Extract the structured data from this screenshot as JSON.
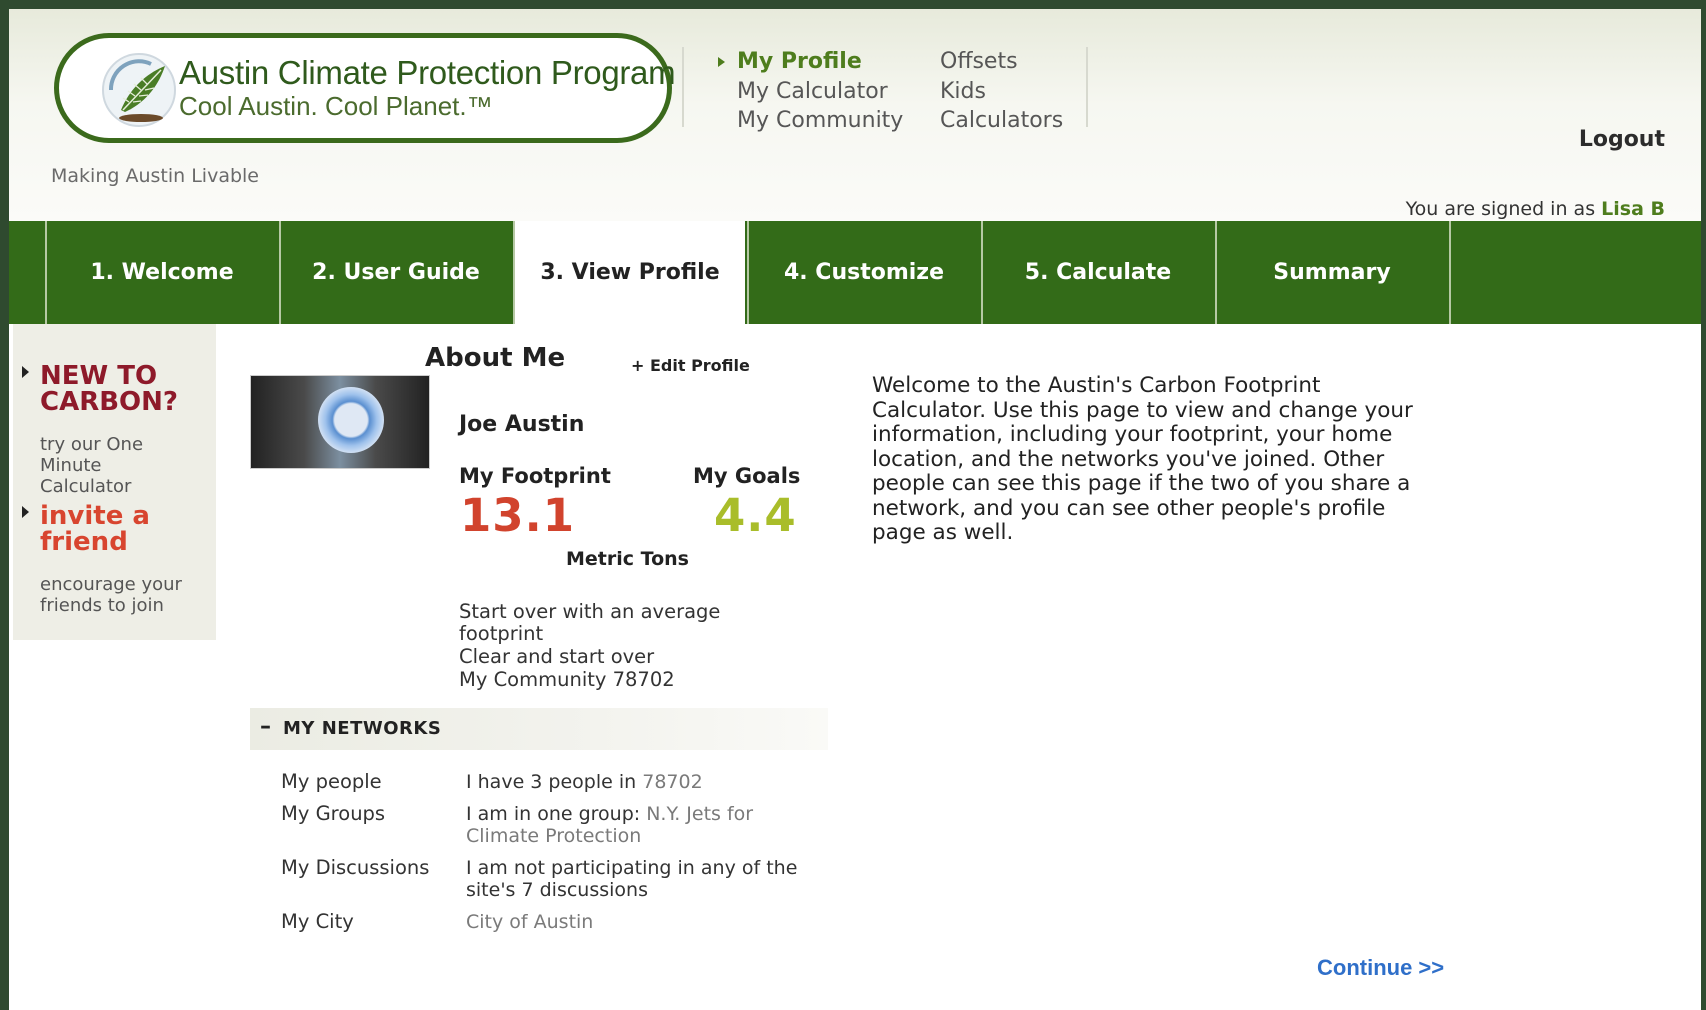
{
  "header": {
    "logo_title": "Austin Climate Protection Program",
    "logo_slogan": "Cool Austin. Cool Planet.™",
    "tagline": "Making Austin Livable",
    "nav_col1": [
      {
        "label": "My Profile",
        "active": true
      },
      {
        "label": "My Calculator",
        "active": false
      },
      {
        "label": "My Community",
        "active": false
      }
    ],
    "nav_col2": [
      {
        "label": "Offsets"
      },
      {
        "label": "Kids"
      },
      {
        "label": "Calculators"
      }
    ],
    "logout": "Logout",
    "signed_in_prefix": "You are signed in as",
    "signed_in_user": "Lisa B"
  },
  "tabs": [
    {
      "label": "1. Welcome",
      "active": false
    },
    {
      "label": "2. User Guide",
      "active": false
    },
    {
      "label": "3. View Profile",
      "active": true
    },
    {
      "label": "4. Customize",
      "active": false
    },
    {
      "label": "5. Calculate",
      "active": false
    },
    {
      "label": "Summary",
      "active": false
    }
  ],
  "sidebar": {
    "new_to_carbon": {
      "heading_line1": "NEW TO",
      "heading_line2": "CARBON?",
      "sub_lines": [
        "try our One",
        "Minute",
        "Calculator"
      ]
    },
    "invite": {
      "heading_line1": "invite a",
      "heading_line2": "friend",
      "sub_lines": [
        "encourage your",
        "friends to join"
      ]
    }
  },
  "profile": {
    "about_title": "About Me",
    "edit_profile": "+ Edit Profile",
    "name": "Joe Austin",
    "footprint_label": "My Footprint",
    "footprint_value": "13.1",
    "goals_label": "My Goals",
    "goals_value": "4.4",
    "units": "Metric Tons",
    "links": [
      "Start over with an average footprint",
      "Clear and start over",
      "My Community 78702"
    ]
  },
  "networks": {
    "title": "MY NETWORKS",
    "rows": [
      {
        "label": "My people",
        "text": "I have 3 people in ",
        "link": "78702"
      },
      {
        "label": "My Groups",
        "text": "I am in one group: ",
        "link": "N.Y. Jets for Climate Protection"
      },
      {
        "label": "My Discussions",
        "text": "I am not participating in any of the site's 7 discussions",
        "link": ""
      },
      {
        "label": "My City",
        "text": "",
        "link": "City of Austin"
      }
    ]
  },
  "welcome_text": "Welcome to the Austin's Carbon Footprint Calculator. Use this page to view and change your information, including your footprint, your home location, and the networks you've joined. Other people can see this page if the two of you share a network, and you can see other people's profile page as well.",
  "continue_label": "Continue >>",
  "colors": {
    "brand_green": "#336b18",
    "footprint_red": "#d1432d",
    "goal_green": "#a9bd2a",
    "link_blue": "#2f6fc9"
  }
}
